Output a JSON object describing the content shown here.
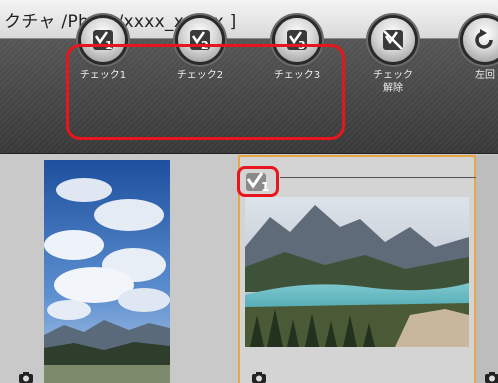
{
  "window": {
    "title": "クチャ /Photo/xxxx_xx_xx ]"
  },
  "toolbar": {
    "buttons": [
      {
        "id": "check1",
        "label": "チェック1",
        "icon": "check-1-icon"
      },
      {
        "id": "check2",
        "label": "チェック2",
        "icon": "check-2-icon"
      },
      {
        "id": "check3",
        "label": "チェック3",
        "icon": "check-3-icon"
      },
      {
        "id": "uncheck",
        "label": "チェック\n解除",
        "icon": "uncheck-icon"
      },
      {
        "id": "rotate-left",
        "label": "左回",
        "icon": "rotate-left-icon"
      }
    ]
  },
  "thumbnails": [
    {
      "id": "portrait-sky",
      "selected": false
    },
    {
      "id": "lake-landscape",
      "selected": true,
      "check_mark": "1"
    }
  ],
  "colors": {
    "highlight": "#e8141e",
    "selection_border": "#e6a64a",
    "toolbar_bg": "#444444"
  }
}
